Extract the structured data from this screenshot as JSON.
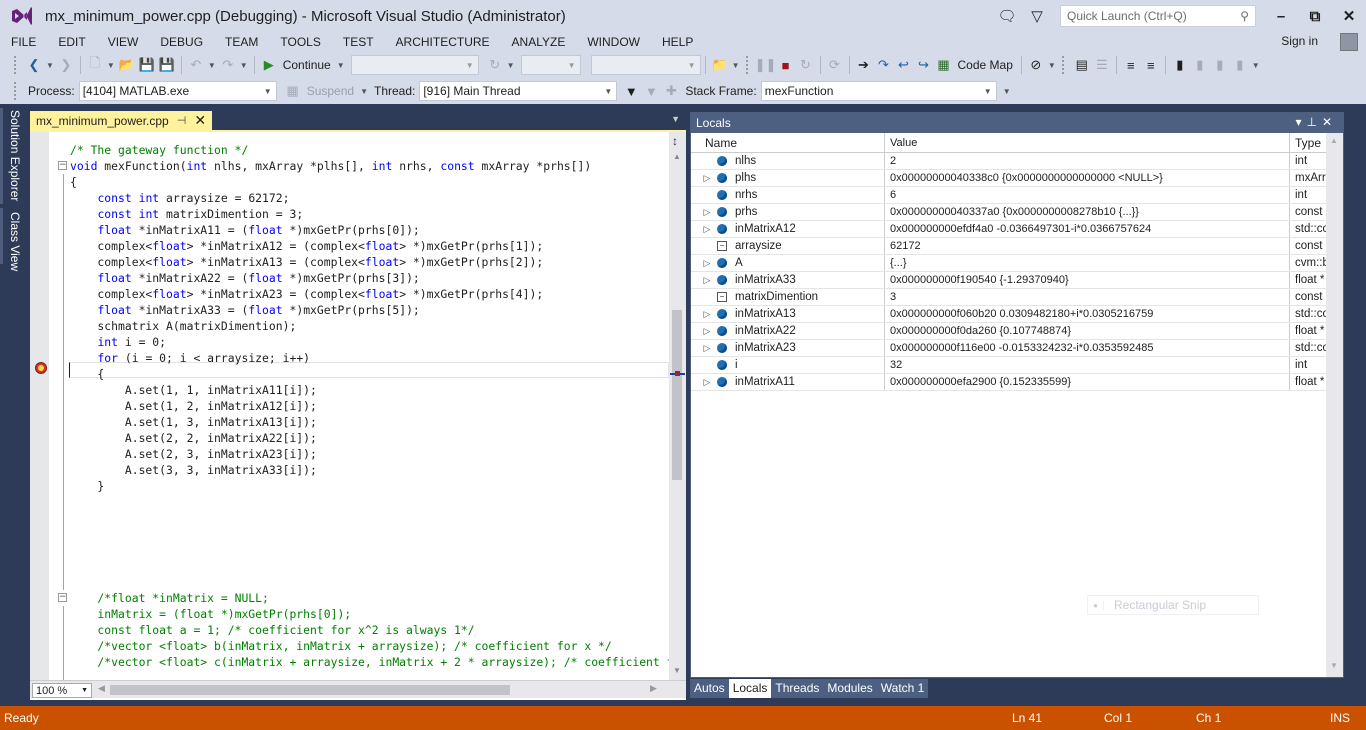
{
  "window": {
    "title": "mx_minimum_power.cpp (Debugging) - Microsoft Visual Studio (Administrator)",
    "quick_launch_placeholder": "Quick Launch (Ctrl+Q)",
    "sign_in": "Sign in"
  },
  "menu": [
    "FILE",
    "EDIT",
    "VIEW",
    "DEBUG",
    "TEAM",
    "TOOLS",
    "TEST",
    "ARCHITECTURE",
    "ANALYZE",
    "WINDOW",
    "HELP"
  ],
  "toolbar": {
    "continue_label": "Continue",
    "code_map_label": "Code Map"
  },
  "debug_location": {
    "process_label": "Process:",
    "process_value": "[4104] MATLAB.exe",
    "suspend_label": "Suspend",
    "thread_label": "Thread:",
    "thread_value": "[916] Main Thread",
    "stack_frame_label": "Stack Frame:",
    "stack_frame_value": "mexFunction"
  },
  "side_tabs": [
    "Solution Explorer",
    "Class View"
  ],
  "editor": {
    "tab_name": "mx_minimum_power.cpp",
    "zoom": "100 %",
    "lines": [
      {
        "text": "/* The gateway function */",
        "type": "comment"
      },
      {
        "text": "void mexFunction(int nlhs, mxArray *plhs[], int nrhs, const mxArray *prhs[])",
        "type": "code"
      },
      {
        "text": "{",
        "type": "code"
      },
      {
        "text": "    const int arraysize = 62172;",
        "type": "code"
      },
      {
        "text": "    const int matrixDimention = 3;",
        "type": "code"
      },
      {
        "text": "    float *inMatrixA11 = (float *)mxGetPr(prhs[0]);",
        "type": "code"
      },
      {
        "text": "    complex<float> *inMatrixA12 = (complex<float> *)mxGetPr(prhs[1]);",
        "type": "code"
      },
      {
        "text": "    complex<float> *inMatrixA13 = (complex<float> *)mxGetPr(prhs[2]);",
        "type": "code"
      },
      {
        "text": "    float *inMatrixA22 = (float *)mxGetPr(prhs[3]);",
        "type": "code"
      },
      {
        "text": "    complex<float> *inMatrixA23 = (complex<float> *)mxGetPr(prhs[4]);",
        "type": "code"
      },
      {
        "text": "    float *inMatrixA33 = (float *)mxGetPr(prhs[5]);",
        "type": "code"
      },
      {
        "text": "    schmatrix A(matrixDimention);",
        "type": "code"
      },
      {
        "text": "    int i = 0;",
        "type": "code"
      },
      {
        "text": "    for (i = 0; i < arraysize; i++)",
        "type": "code"
      },
      {
        "text": "    {",
        "type": "code"
      },
      {
        "text": "        A.set(1, 1, inMatrixA11[i]);",
        "type": "code"
      },
      {
        "text": "        A.set(1, 2, inMatrixA12[i]);",
        "type": "code"
      },
      {
        "text": "        A.set(1, 3, inMatrixA13[i]);",
        "type": "code"
      },
      {
        "text": "        A.set(2, 2, inMatrixA22[i]);",
        "type": "code"
      },
      {
        "text": "        A.set(2, 3, inMatrixA23[i]);",
        "type": "code"
      },
      {
        "text": "        A.set(3, 3, inMatrixA33[i]);",
        "type": "code"
      },
      {
        "text": "    }",
        "type": "code"
      },
      {
        "text": "",
        "type": "code"
      },
      {
        "text": "",
        "type": "code"
      },
      {
        "text": "",
        "type": "code"
      },
      {
        "text": "",
        "type": "code"
      },
      {
        "text": "",
        "type": "code"
      },
      {
        "text": "",
        "type": "code"
      },
      {
        "text": "    /*float *inMatrix = NULL;",
        "type": "comment"
      },
      {
        "text": "    inMatrix = (float *)mxGetPr(prhs[0]);",
        "type": "comment"
      },
      {
        "text": "    const float a = 1; /* coefficient for x^2 is always 1*/",
        "type": "comment"
      },
      {
        "text": "    /*vector <float> b(inMatrix, inMatrix + arraysize); /* coefficient for x */",
        "type": "comment"
      },
      {
        "text": "    /*vector <float> c(inMatrix + arraysize, inMatrix + 2 * arraysize); /* coefficient for",
        "type": "comment"
      }
    ]
  },
  "locals": {
    "title": "Locals",
    "columns": [
      "Name",
      "Value",
      "Type"
    ],
    "rows": [
      {
        "name": "nlhs",
        "value": "2",
        "type": "int",
        "expandable": false,
        "icon": "variable"
      },
      {
        "name": "plhs",
        "value": "0x00000000040338c0 {0x0000000000000000 <NULL>}",
        "type": "mxArray_",
        "expandable": true,
        "icon": "variable"
      },
      {
        "name": "nrhs",
        "value": "6",
        "type": "int",
        "expandable": false,
        "icon": "variable"
      },
      {
        "name": "prhs",
        "value": "0x00000000040337a0 {0x0000000008278b10 {...}}",
        "type": "const mx",
        "expandable": true,
        "icon": "variable"
      },
      {
        "name": "inMatrixA12",
        "value": "0x000000000efdf4a0 -0.0366497301-i*0.0366757624",
        "type": "std::com",
        "expandable": true,
        "icon": "variable"
      },
      {
        "name": "arraysize",
        "value": "62172",
        "type": "const int",
        "expandable": false,
        "icon": "constant"
      },
      {
        "name": "A",
        "value": "{...}",
        "type": "cvm::bas",
        "expandable": true,
        "icon": "variable"
      },
      {
        "name": "inMatrixA33",
        "value": "0x000000000f190540 {-1.29370940}",
        "type": "float *",
        "expandable": true,
        "icon": "variable"
      },
      {
        "name": "matrixDimention",
        "value": "3",
        "type": "const int",
        "expandable": false,
        "icon": "constant"
      },
      {
        "name": "inMatrixA13",
        "value": "0x000000000f060b20 0.0309482180+i*0.0305216759",
        "type": "std::com",
        "expandable": true,
        "icon": "variable"
      },
      {
        "name": "inMatrixA22",
        "value": "0x000000000f0da260 {0.107748874}",
        "type": "float *",
        "expandable": true,
        "icon": "variable"
      },
      {
        "name": "inMatrixA23",
        "value": "0x000000000f116e00 -0.0153324232-i*0.0353592485",
        "type": "std::com",
        "expandable": true,
        "icon": "variable"
      },
      {
        "name": "i",
        "value": "32",
        "type": "int",
        "expandable": false,
        "icon": "variable"
      },
      {
        "name": "inMatrixA11",
        "value": "0x000000000efa2900 {0.152335599}",
        "type": "float *",
        "expandable": true,
        "icon": "variable"
      }
    ],
    "snip_overlay": "Rectangular Snip"
  },
  "bottom_tabs": [
    {
      "label": "Autos",
      "active": false
    },
    {
      "label": "Locals",
      "active": true
    },
    {
      "label": "Threads",
      "active": false
    },
    {
      "label": "Modules",
      "active": false
    },
    {
      "label": "Watch 1",
      "active": false
    }
  ],
  "status": {
    "text": "Ready",
    "ln": "Ln 41",
    "col": "Col 1",
    "ch": "Ch 1",
    "mode": "INS"
  },
  "colors": {
    "status_bar": "#ca5100",
    "tab_active": "#fff29d",
    "keyword": "#0000ff",
    "comment": "#008000"
  }
}
